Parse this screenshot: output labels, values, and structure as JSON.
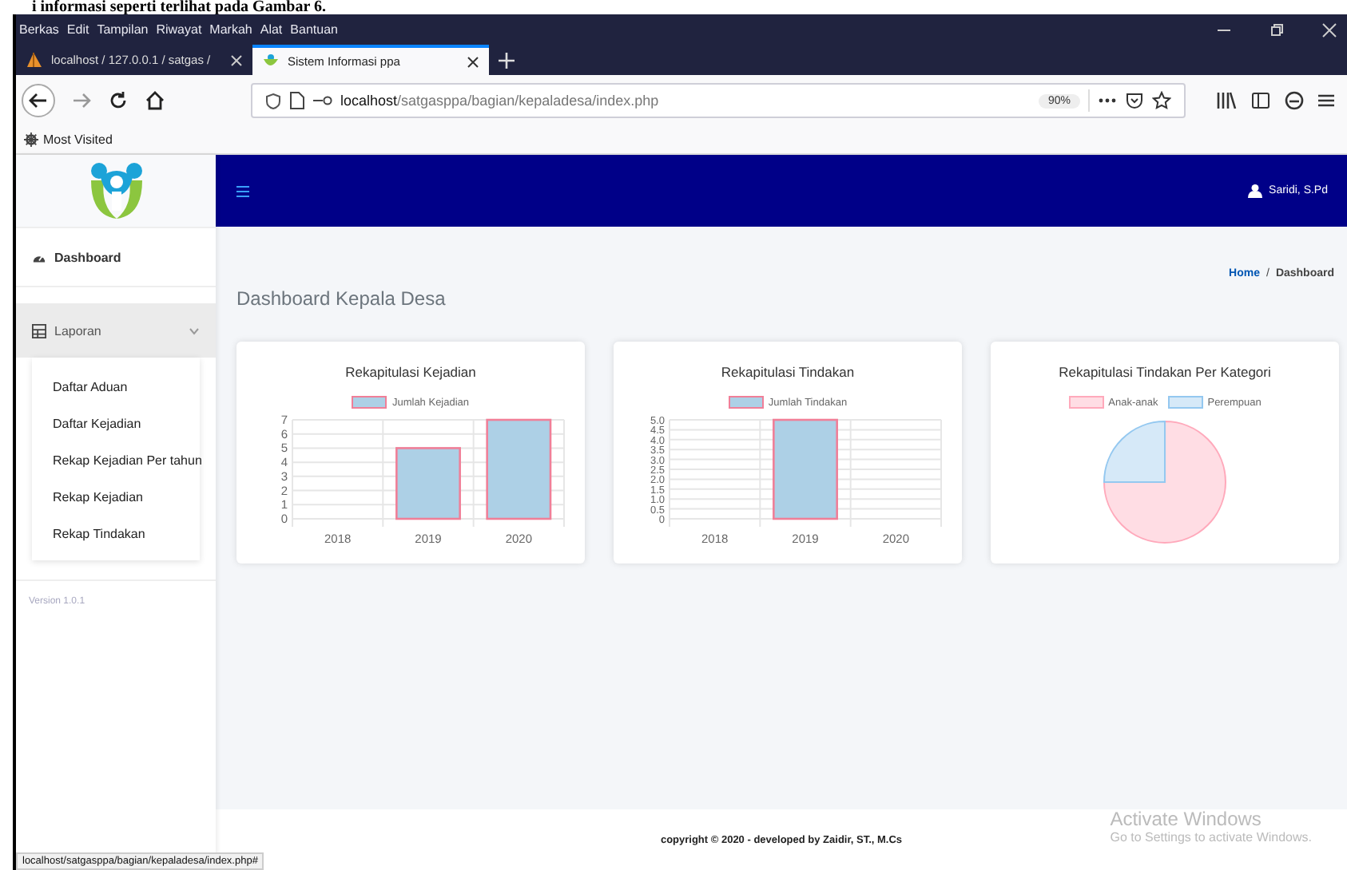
{
  "caption_fragment": "i informasi seperti terlihat pada Gambar 6.",
  "browser": {
    "menu": [
      "Berkas",
      "Edit",
      "Tampilan",
      "Riwayat",
      "Markah",
      "Alat",
      "Bantuan"
    ],
    "tabs": [
      {
        "title": "localhost / 127.0.0.1 / satgas / ",
        "selected": false
      },
      {
        "title": "Sistem Informasi ppa",
        "selected": true
      }
    ],
    "address": {
      "host": "localhost",
      "path": "/satgasppa/bagian/kepaladesa/index.php"
    },
    "zoom": "90%",
    "bookmarks": [
      "Most Visited"
    ],
    "status_url": "localhost/satgasppa/bagian/kepaladesa/index.php#"
  },
  "app": {
    "user": "Saridi, S.Pd",
    "sidebar": {
      "items": [
        {
          "label": "Dashboard",
          "kind": "link"
        },
        {
          "label": "Laporan",
          "kind": "group",
          "expanded": true,
          "children": [
            {
              "label": "Daftar Aduan"
            },
            {
              "label": "Daftar Kejadian"
            },
            {
              "label": "Rekap Kejadian Per tahun"
            },
            {
              "label": "Rekap Kejadian"
            },
            {
              "label": "Rekap Tindakan"
            }
          ]
        }
      ],
      "version": "Version 1.0.1"
    },
    "page_title": "Dashboard Kepala Desa",
    "breadcrumb": [
      "Home",
      "Dashboard"
    ],
    "breadcrumb_separator": "/",
    "cards": [
      {
        "title": "Rekapitulasi Kejadian",
        "chart_data": {
          "type": "bar",
          "categories": [
            "2018",
            "2019",
            "2020"
          ],
          "series": [
            {
              "name": "Jumlah Kejadian",
              "color": "#add0e6",
              "values": [
                0,
                5,
                7
              ]
            }
          ],
          "grid": true,
          "legend": "top",
          "ylim": [
            0,
            7
          ],
          "yticks": [
            0,
            1,
            2,
            3,
            4,
            5,
            6,
            7
          ]
        }
      },
      {
        "title": "Rekapitulasi Tindakan",
        "chart_data": {
          "type": "bar",
          "categories": [
            "2018",
            "2019",
            "2020"
          ],
          "series": [
            {
              "name": "Jumlah Tindakan",
              "color": "#add0e6",
              "values": [
                0,
                5,
                0
              ]
            }
          ],
          "grid": true,
          "legend": "top",
          "ylim": [
            0,
            5
          ],
          "yticks": [
            0,
            {
              "value": 0.5,
              "label": "0.5"
            },
            {
              "value": 1,
              "label": "1.0"
            },
            {
              "value": 1.5,
              "label": "1.5"
            },
            {
              "value": 2,
              "label": "2.0"
            },
            {
              "value": 2.5,
              "label": "2.5"
            },
            {
              "value": 3,
              "label": "3.0"
            },
            {
              "value": 3.5,
              "label": "3.5"
            },
            {
              "value": 4,
              "label": "4.0"
            },
            {
              "value": 4.5,
              "label": "4.5"
            },
            {
              "value": 5,
              "label": "5.0"
            }
          ]
        }
      },
      {
        "title": "Rekapitulasi Tindakan Per Kategori",
        "chart_data": {
          "type": "pie",
          "categories": [
            "Anak-anak",
            "Perempuan"
          ],
          "series": [
            {
              "values": [
                75,
                25
              ]
            }
          ],
          "legend": "top"
        }
      }
    ],
    "footer": "copyright © 2020 - developed by Zaidir, ST., M.Cs"
  },
  "os_notice": {
    "title": "Activate Windows",
    "text": "Go to Settings to activate Windows."
  }
}
